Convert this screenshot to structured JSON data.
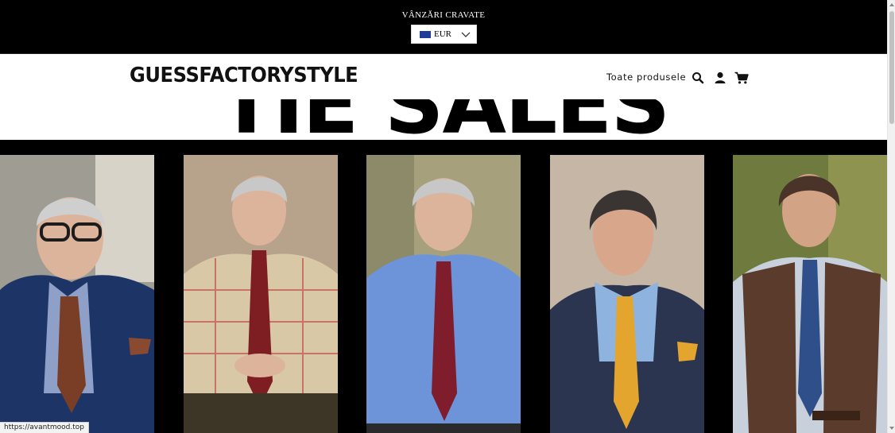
{
  "announcement": {
    "text": "VÂNZĂRI CRAVATE"
  },
  "currency": {
    "code": "EUR",
    "flag_icon": "eu-flag-icon",
    "flag_color": "#1f3c99"
  },
  "header": {
    "logo": "GUESSFACTORYSTYLE",
    "nav_link": "Toate produsele",
    "icons": [
      "search-icon",
      "account-icon",
      "cart-icon"
    ]
  },
  "hero": {
    "title": "TIE SALES"
  },
  "gallery": {
    "products": [
      {
        "name": "tie-product-1",
        "tie_color": "#7a3d26",
        "shirt_color": "#8fa0c8",
        "jacket_color": "#1d3466"
      },
      {
        "name": "tie-product-2",
        "tie_color": "#7e1d22",
        "shirt_color": "#d9c8a6",
        "jacket_color": ""
      },
      {
        "name": "tie-product-3",
        "tie_color": "#7f1d2c",
        "shirt_color": "#6d94d9",
        "jacket_color": ""
      },
      {
        "name": "tie-product-4",
        "tie_color": "#e3a52d",
        "shirt_color": "#8fb3df",
        "jacket_color": "#2b3550"
      },
      {
        "name": "tie-product-5",
        "tie_color": "#2f4f8a",
        "shirt_color": "#c8d0dc",
        "jacket_color": "#5a3b2c"
      }
    ]
  },
  "status_bar": {
    "url": "https://avantmood.top"
  },
  "colors": {
    "bar_bg": "#000000",
    "page_bg": "#ffffff",
    "text": "#111111"
  }
}
